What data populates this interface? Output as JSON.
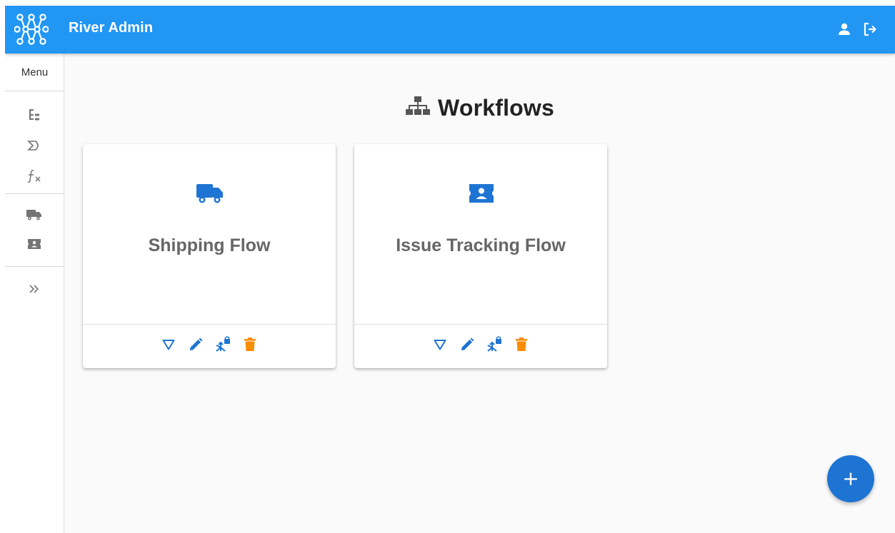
{
  "app": {
    "title": "River Admin"
  },
  "sidebar": {
    "menu_label": "Menu",
    "items": [
      {
        "icon": "tree-list-icon"
      },
      {
        "icon": "sigma-icon"
      },
      {
        "icon": "function-icon"
      },
      {
        "icon": "truck-icon"
      },
      {
        "icon": "ticket-icon"
      },
      {
        "icon": "expand-chevrons-icon"
      }
    ]
  },
  "header": {
    "user_icon": "user-icon",
    "logout_icon": "logout-icon"
  },
  "page": {
    "title": "Workflows",
    "title_icon": "sitemap-icon"
  },
  "workflows": [
    {
      "name": "Shipping Flow",
      "icon": "truck-icon",
      "actions": [
        "filter-icon",
        "edit-icon",
        "permissions-icon",
        "delete-icon"
      ]
    },
    {
      "name": "Issue Tracking Flow",
      "icon": "ticket-icon",
      "actions": [
        "filter-icon",
        "edit-icon",
        "permissions-icon",
        "delete-icon"
      ]
    }
  ],
  "fab": {
    "label": "+"
  },
  "colors": {
    "primary": "#2196f3",
    "accent_blue": "#1e74d2",
    "delete": "#fb8c00",
    "background": "#fafafa"
  }
}
